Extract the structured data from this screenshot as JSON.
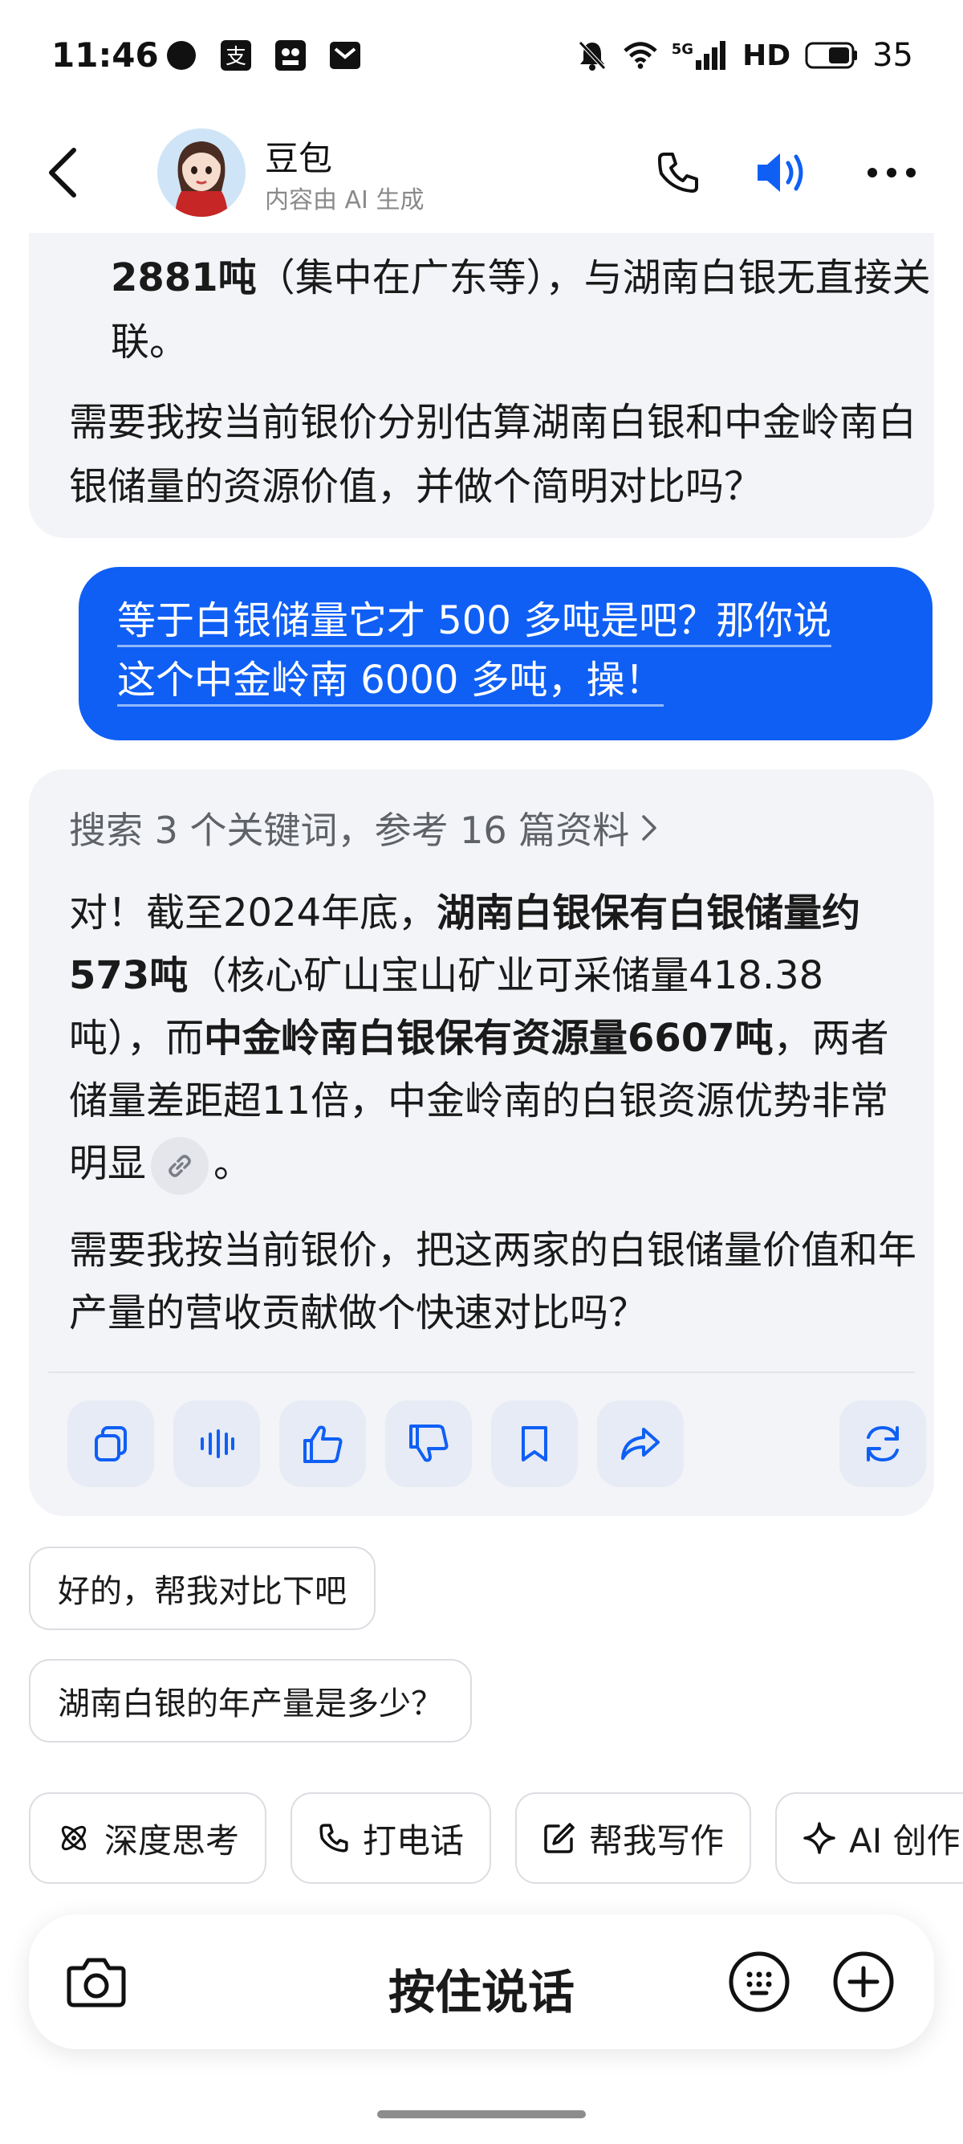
{
  "status_bar": {
    "time": "11:46",
    "signal_label": "5G",
    "hd_label": "HD",
    "battery": "35"
  },
  "header": {
    "title": "豆包",
    "subtitle": "内容由 AI 生成"
  },
  "message_ai_1": {
    "bullet_bold": "2881吨",
    "bullet_text": "（集中在广东等），与湖南白银无直接关联。",
    "paragraph": "需要我按当前银价分别估算湖南白银和中金岭南白银储量的资源价值，并做个简明对比吗？"
  },
  "message_user": {
    "line1": "等于白银储量它才 500 多吨是吧？那你说",
    "line2": "这个中金岭南 6000 多吨，操！"
  },
  "message_ai_2": {
    "search_ref": "搜索 3 个关键词，参考 16 篇资料",
    "p1_a": "对！截至2024年底，",
    "p1_b": "湖南白银保有白银储量约573吨",
    "p1_c": "（核心矿山宝山矿业可采储量418.38吨），而",
    "p1_d": "中金岭南白银保有资源量6607吨",
    "p1_e": "，两者储量差距超11倍，中金岭南的白银资源优势非常明显",
    "p1_f": "。",
    "p2": "需要我按当前银价，把这两家的白银储量价值和年产量的营收贡献做个快速对比吗？"
  },
  "suggestions": [
    "好的，帮我对比下吧",
    "湖南白银的年产量是多少？"
  ],
  "tools": [
    {
      "label": "深度思考",
      "icon": "atom-icon"
    },
    {
      "label": "打电话",
      "icon": "phone-icon"
    },
    {
      "label": "帮我写作",
      "icon": "edit-icon"
    },
    {
      "label": "AI 创作",
      "icon": "sparkle-icon"
    }
  ],
  "input_bar": {
    "hold_to_talk": "按住说话"
  },
  "colors": {
    "accent": "#0f5ff5",
    "bubble_ai": "#f3f4f7",
    "action_btn": "#e6ebf5"
  }
}
